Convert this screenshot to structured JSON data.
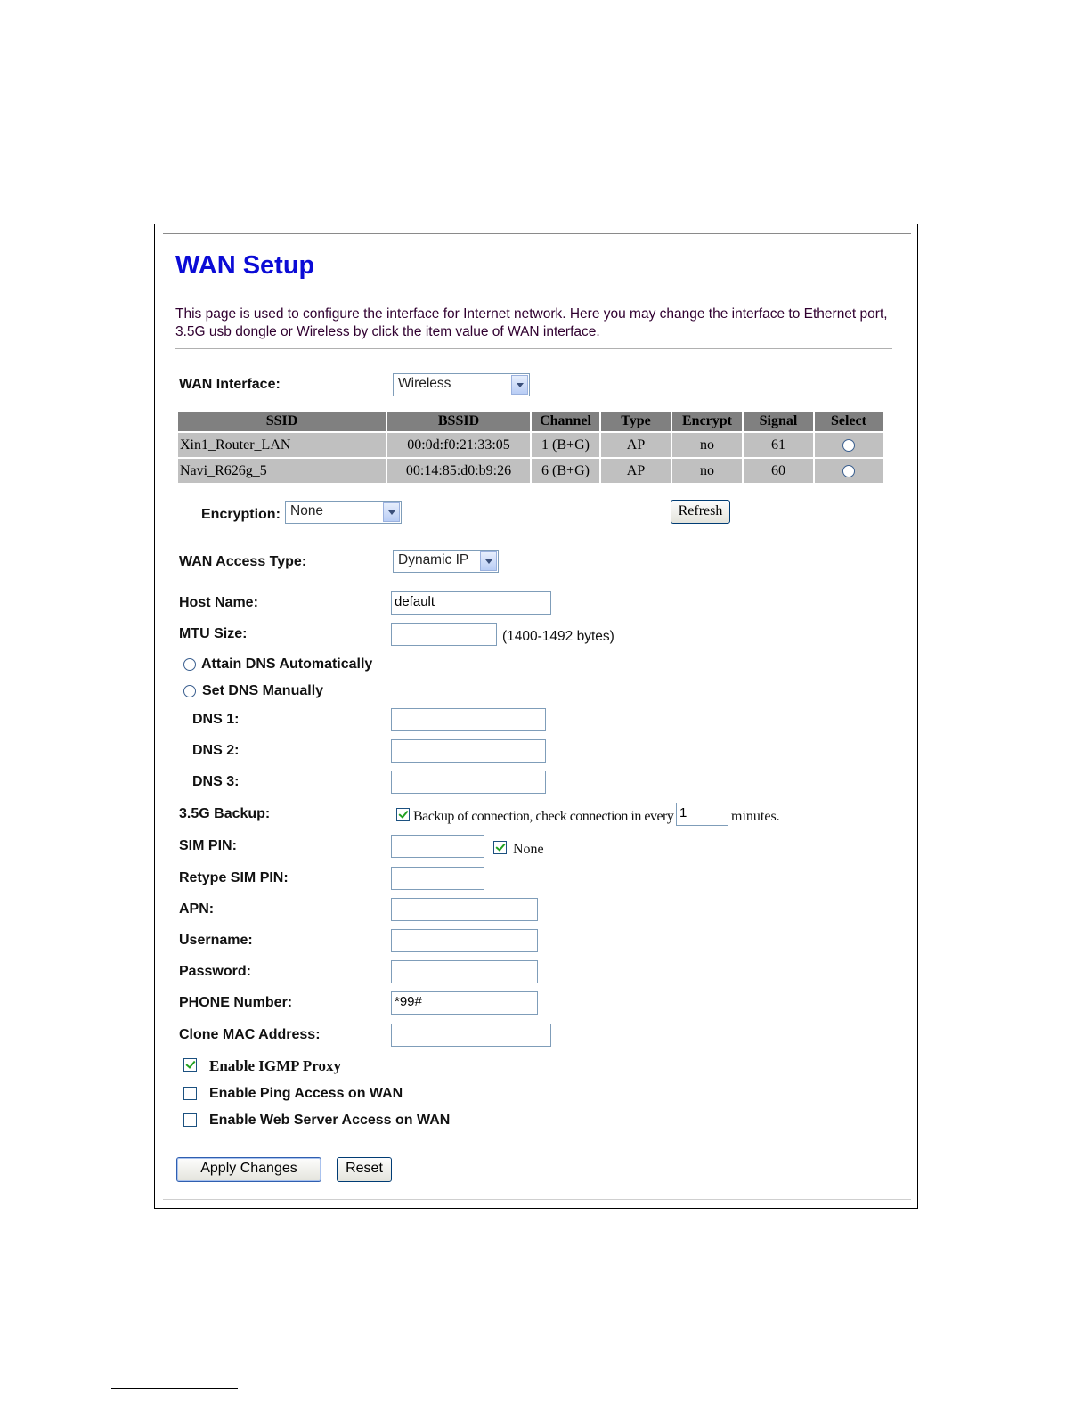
{
  "title": "WAN Setup",
  "description": "This page is used to configure the interface for Internet network. Here you may change the interface to Ethernet port, 3.5G usb dongle or Wireless by click the item value of WAN interface.",
  "wan_interface": {
    "label": "WAN Interface:",
    "value": "Wireless"
  },
  "scan_table": {
    "headers": [
      "SSID",
      "BSSID",
      "Channel",
      "Type",
      "Encrypt",
      "Signal",
      "Select"
    ],
    "rows": [
      {
        "ssid": "Xin1_Router_LAN",
        "bssid": "00:0d:f0:21:33:05",
        "channel": "1 (B+G)",
        "type": "AP",
        "encrypt": "no",
        "signal": "61"
      },
      {
        "ssid": "Navi_R626g_5",
        "bssid": "00:14:85:d0:b9:26",
        "channel": "6 (B+G)",
        "type": "AP",
        "encrypt": "no",
        "signal": "60"
      }
    ]
  },
  "encryption": {
    "label": "Encryption:",
    "value": "None"
  },
  "refresh_label": "Refresh",
  "wan_access_type": {
    "label": "WAN Access Type:",
    "value": "Dynamic IP"
  },
  "host_name": {
    "label": "Host Name:",
    "value": "default"
  },
  "mtu": {
    "label": "MTU Size:",
    "value": "",
    "hint": "(1400-1492 bytes)"
  },
  "dns_auto_label": "Attain DNS Automatically",
  "dns_manual_label": "Set DNS Manually",
  "dns1": {
    "label": "DNS 1:",
    "value": ""
  },
  "dns2": {
    "label": "DNS 2:",
    "value": ""
  },
  "dns3": {
    "label": "DNS 3:",
    "value": ""
  },
  "backup": {
    "label": "3.5G Backup:",
    "checkbox_text": "Backup of connection, check connection in every",
    "minutes_value": "1",
    "minutes_label": "minutes.",
    "checked": true
  },
  "sim_pin": {
    "label": "SIM PIN:",
    "value": "",
    "none_label": "None",
    "none_checked": true
  },
  "retype_sim_pin": {
    "label": "Retype SIM PIN:",
    "value": ""
  },
  "apn": {
    "label": "APN:",
    "value": ""
  },
  "username": {
    "label": "Username:",
    "value": ""
  },
  "password": {
    "label": "Password:",
    "value": ""
  },
  "phone": {
    "label": "PHONE Number:",
    "value": "*99#"
  },
  "clone_mac": {
    "label": "Clone MAC Address:",
    "value": ""
  },
  "options": {
    "igmp": {
      "label": "Enable IGMP Proxy",
      "checked": true
    },
    "ping": {
      "label": "Enable Ping Access on WAN",
      "checked": false
    },
    "web": {
      "label": "Enable Web Server Access on WAN",
      "checked": false
    }
  },
  "buttons": {
    "apply": "Apply Changes",
    "reset": "Reset"
  }
}
